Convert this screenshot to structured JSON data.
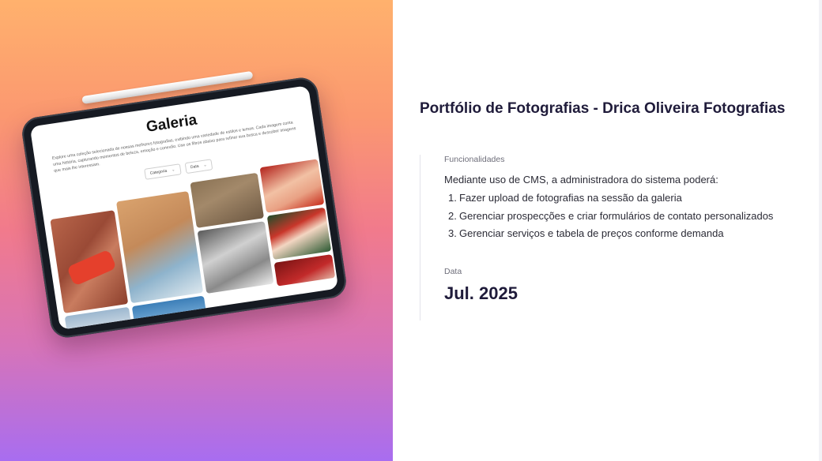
{
  "mockup": {
    "gallery_title": "Galeria",
    "gallery_description": "Explore uma coleção selecionada de nossas melhores fotografias, exibindo uma variedade de estilos e temas. Cada imagem conta uma história, capturando momentos de beleza, emoção e conexão. Use os filtros abaixo para refinar sua busca e descobrir imagens que mais lhe interessam.",
    "filters": [
      "Categoria",
      "Data"
    ]
  },
  "project": {
    "title": "Portfólio de Fotografias - Drica Oliveira Fotografias"
  },
  "features": {
    "label": "Funcionalidades",
    "intro": "Mediante uso de CMS, a administradora do sistema poderá:",
    "items": [
      "Fazer upload de fotografias na sessão da galeria",
      "Gerenciar prospecções e criar formulários de contato personalizados",
      "Gerenciar serviços e tabela de preços conforme demanda"
    ]
  },
  "date": {
    "label": "Data",
    "value": "Jul. 2025"
  },
  "colors": {
    "gradient_top": "#ffb16d",
    "gradient_bottom": "#a86df0",
    "title_color": "#1f1b3a",
    "text_color": "#2b2b36"
  }
}
